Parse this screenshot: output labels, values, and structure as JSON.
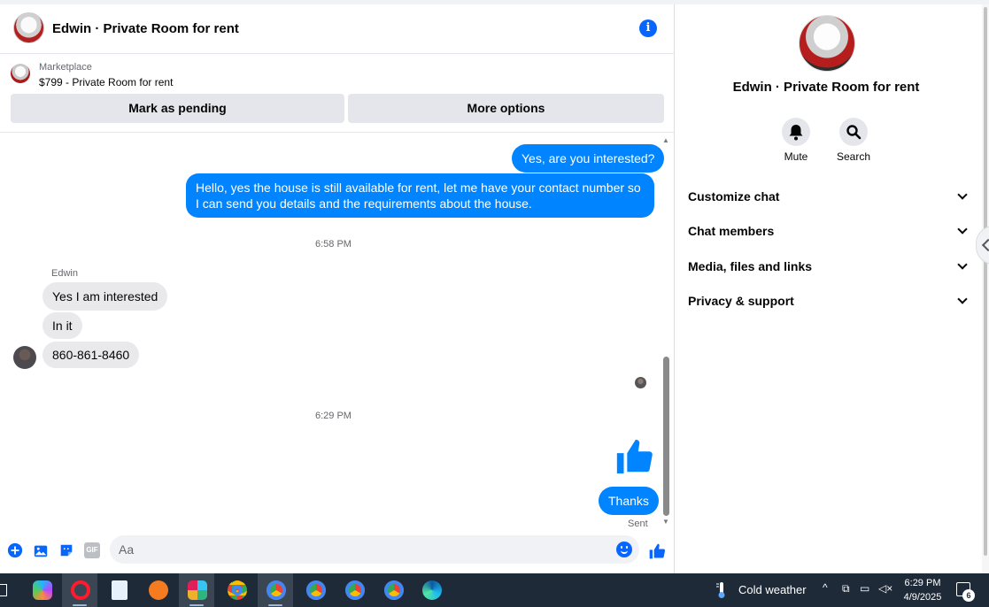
{
  "chat": {
    "title": "Edwin · Private Room for rent",
    "marketplace": {
      "label": "Marketplace",
      "item": "$799 - Private Room for rent",
      "pending_button": "Mark as pending",
      "more_button": "More options"
    },
    "messages": {
      "out1": "Yes, are you interested?",
      "out2": "Hello, yes the house is still available for rent, let me have your contact number so I can send you details and the requirements about the house.",
      "time1": "6:58 PM",
      "sender": "Edwin",
      "in1": "Yes I am interested",
      "in2": "In it",
      "in3": "860-861-8460",
      "time2": "6:29 PM",
      "out3": "Thanks",
      "status": "Sent"
    },
    "composer": {
      "placeholder": "Aa",
      "gif_label": "GIF"
    }
  },
  "panel": {
    "title": "Edwin · Private Room for rent",
    "actions": {
      "mute": "Mute",
      "search": "Search"
    },
    "sections": {
      "customize": "Customize chat",
      "members": "Chat members",
      "media": "Media, files and links",
      "privacy": "Privacy & support"
    }
  },
  "taskbar": {
    "weather": "Cold weather",
    "time": "6:29 PM",
    "date": "4/9/2025",
    "notifications": "6"
  },
  "colors": {
    "messenger_blue": "#0084ff",
    "accent_blue": "#0866ff",
    "incoming_bubble": "#e9e9eb",
    "taskbar": "#1f2a38"
  }
}
